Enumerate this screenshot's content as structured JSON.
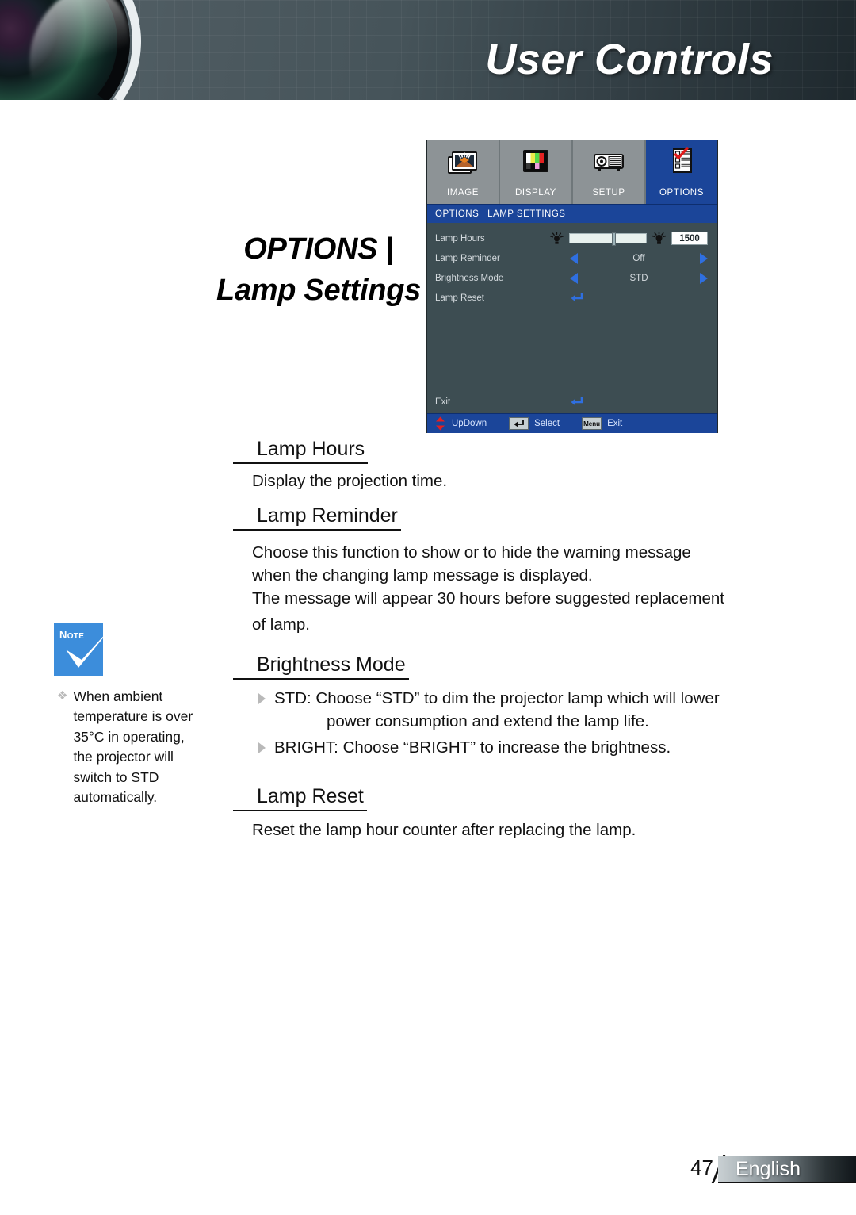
{
  "header": {
    "title": "User Controls",
    "lens_icon": "camera-lens-graphic"
  },
  "page_title": {
    "line1": "OPTIONS |",
    "line2": "Lamp Settings"
  },
  "osd": {
    "tabs": [
      {
        "label": "IMAGE",
        "icon": "image-photos-icon",
        "selected": false
      },
      {
        "label": "DISPLAY",
        "icon": "color-bars-icon",
        "selected": false
      },
      {
        "label": "SETUP",
        "icon": "projector-icon",
        "selected": false
      },
      {
        "label": "OPTIONS",
        "icon": "checklist-icon",
        "selected": true
      }
    ],
    "breadcrumb": "OPTIONS | LAMP SETTINGS",
    "rows": [
      {
        "label": "Lamp Hours",
        "type": "slider",
        "value": "1500",
        "slider_percent": 55,
        "left_icon": "lamp-small-icon",
        "right_icon": "lamp-large-icon"
      },
      {
        "label": "Lamp Reminder",
        "type": "stepper",
        "value": "Off"
      },
      {
        "label": "Brightness Mode",
        "type": "stepper",
        "value": "STD"
      },
      {
        "label": "Lamp Reset",
        "type": "enter",
        "value": ""
      }
    ],
    "exit_row": {
      "label": "Exit",
      "icon": "enter-arrow-icon"
    },
    "footbar": [
      {
        "key_icon": "updown-arrows-icon",
        "key_text": "",
        "label": "UpDown"
      },
      {
        "key_icon": "enter-key-icon",
        "key_text": "",
        "label": "Select"
      },
      {
        "key_icon": "menu-key-icon",
        "key_text": "Menu",
        "label": "Exit"
      }
    ],
    "colors": {
      "title_bar": "#1b4599",
      "body": "#3d4d52",
      "tab_bar": "#8d9396",
      "arrow_blue": "#2f6fe0"
    }
  },
  "sections": [
    {
      "heading": "Lamp Hours",
      "paragraph": "Display the projection time."
    },
    {
      "heading": "Lamp Reminder",
      "paragraph_lines": [
        "Choose this function to show or to hide the warning message",
        "when the changing lamp message is displayed.",
        "The message will appear 30 hours before suggested replacement",
        "of lamp."
      ]
    },
    {
      "heading": "Brightness Mode",
      "bullets": [
        {
          "line1": "STD: Choose “STD” to dim the projector lamp which will lower",
          "line2": "power consumption and extend the lamp life."
        },
        {
          "line1": "BRIGHT: Choose “BRIGHT” to increase the brightness.",
          "line2": ""
        }
      ]
    },
    {
      "heading": "Lamp Reset",
      "paragraph": "Reset the lamp hour counter after replacing the lamp."
    }
  ],
  "note": {
    "badge_label": "Note",
    "badge_color": "#3c8ddb",
    "text": "When ambient temperature is over 35°C in operating, the projector will switch to STD automatically."
  },
  "footer": {
    "page_number": "47",
    "language": "English"
  }
}
